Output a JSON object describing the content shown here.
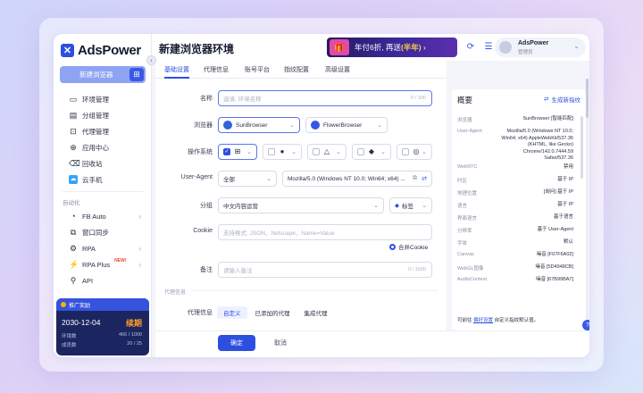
{
  "brand": {
    "name": "AdsPower"
  },
  "sidebar": {
    "new_browser_label": "新建浏览器",
    "items": [
      {
        "label": "环境管理",
        "icon": "folder-icon"
      },
      {
        "label": "分组管理",
        "icon": "group-icon"
      },
      {
        "label": "代理管理",
        "icon": "proxy-icon"
      },
      {
        "label": "应用中心",
        "icon": "apps-icon"
      },
      {
        "label": "回收站",
        "icon": "trash-icon"
      },
      {
        "label": "云手机",
        "icon": "cloud-phone-icon"
      }
    ],
    "automation_section": "自动化",
    "automation_items": [
      {
        "label": "FB Auto"
      },
      {
        "label": "窗口同步"
      },
      {
        "label": "RPA"
      },
      {
        "label": "RPA Plus",
        "tag": "NEW!"
      },
      {
        "label": "API"
      }
    ],
    "promo": {
      "header": "推广奖励",
      "date": "2030-12-04",
      "status": "续期",
      "row1_label": "环境数",
      "row1_value": "466 / 1000",
      "row2_label": "成员数",
      "row2_value": "20 / 25"
    }
  },
  "header": {
    "title": "新建浏览器环境",
    "banner_text_a": "年付6折, 再送",
    "banner_text_b": "(半年)",
    "banner_suffix": "›",
    "user_name": "AdsPower",
    "user_role": "管理员"
  },
  "tabs": [
    "基础设置",
    "代理信息",
    "账号平台",
    "指纹配置",
    "高级设置"
  ],
  "form": {
    "name_label": "名称",
    "name_placeholder": "选填: 环境名称",
    "name_counter": "0 / 100",
    "browser_label": "浏览器",
    "browser_a": "SunBrowser",
    "browser_b": "FlowerBrowser",
    "os_label": "操作系统",
    "ua_label": "User-Agent",
    "ua_mode": "全部",
    "ua_value": "Mozilla/5.0 (Windows NT 10.0; Win64; x64) ...",
    "group_label": "分组",
    "group_value": "中文内容运营",
    "tag_label": "标签",
    "cookie_label": "Cookie",
    "cookie_placeholder": "支持格式: JSON、Netscape、Name=Value",
    "merge_cookie": "合并Cookie",
    "remark_label": "备注",
    "remark_placeholder": "请输入备注",
    "remark_counter": "0 / 1500",
    "proxy_section": "代理信息",
    "proxy_label": "代理信息",
    "proxy_tabs": [
      "自定义",
      "已添加的代理",
      "集成代理"
    ]
  },
  "footer": {
    "ok": "确定",
    "cancel": "取消"
  },
  "overview": {
    "title": "概要",
    "generate": "生成新指纹",
    "rows": [
      {
        "k": "浏览器",
        "v": "SunBrowser [智能匹配]"
      },
      {
        "k": "User-Agent",
        "v": "Mozilla/5.0 (Windows NT 10.0; Win64; x64) AppleWebKit/537.36 (KHTML, like Gecko) Chrome/142.0.7444.59 Safari/537.36"
      },
      {
        "k": "WebRTC",
        "v": "禁用"
      },
      {
        "k": "时区",
        "v": "基于 IP"
      },
      {
        "k": "地理位置",
        "v": "[询问] 基于 IP"
      },
      {
        "k": "语言",
        "v": "基于 IP"
      },
      {
        "k": "界面语言",
        "v": "基于语言"
      },
      {
        "k": "分辨率",
        "v": "基于 User-Agent"
      },
      {
        "k": "字体",
        "v": "默认"
      },
      {
        "k": "Canvas",
        "v": "噪音 [F07F6A02]"
      },
      {
        "k": "WebGL图像",
        "v": "噪音 [5D4948CB]"
      },
      {
        "k": "AudioContext",
        "v": "噪音 [67B99BA7]"
      }
    ],
    "foot_text_a": "可前往",
    "foot_link": "偏好设置",
    "foot_text_b": "自定义指纹默认值。"
  }
}
